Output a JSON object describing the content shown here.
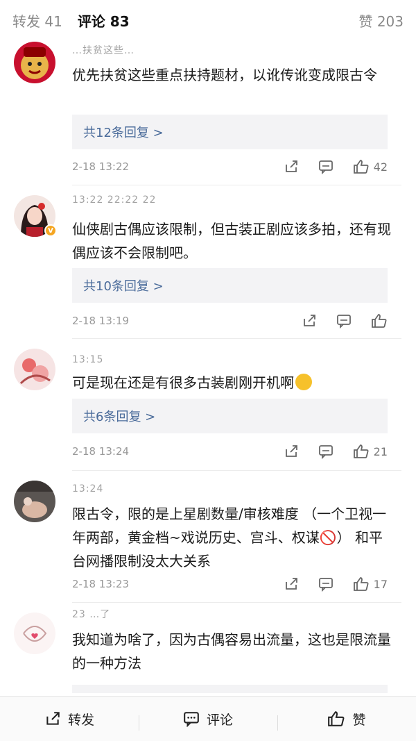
{
  "tabs": {
    "repost": "转发 41",
    "comments": "评论 83",
    "likes": "赞 203"
  },
  "comments": [
    {
      "username": "…扶贫这些…",
      "text": "优先扶贫这些重点扶持题材，以讹传讹变成限古令",
      "replies": "共12条回复 >",
      "time": "2-18 13:22",
      "likes": "42"
    },
    {
      "username": "13:22 22:22 22",
      "text": "仙侠剧古偶应该限制，但古装正剧应该多拍，还有现偶应该不会限制吧。",
      "replies": "共10条回复 >",
      "time": "2-18 13:19",
      "likes": ""
    },
    {
      "username": "13:15",
      "text": "可是现在还是有很多古装剧刚开机啊",
      "replies": "共6条回复 >",
      "time": "2-18 13:24",
      "likes": "21"
    },
    {
      "username": "13:24",
      "text": "限古令，限的是上星剧数量/审核难度 （一个卫视一年两部，黄金档~戏说历史、宫斗、权谋🚫） 和平台网播限制没太大关系",
      "time": "2-18 13:23",
      "likes": "17"
    },
    {
      "username": "23 …了",
      "text": "我知道为啥了，因为古偶容易出流量，这也是限流量的一种方法"
    }
  ],
  "bottom": {
    "repost": "转发",
    "comment": "评论",
    "like": "赞"
  },
  "colors": {
    "link": "#4a6b9a",
    "reply_bg": "#f3f3f5",
    "muted": "#999999"
  }
}
